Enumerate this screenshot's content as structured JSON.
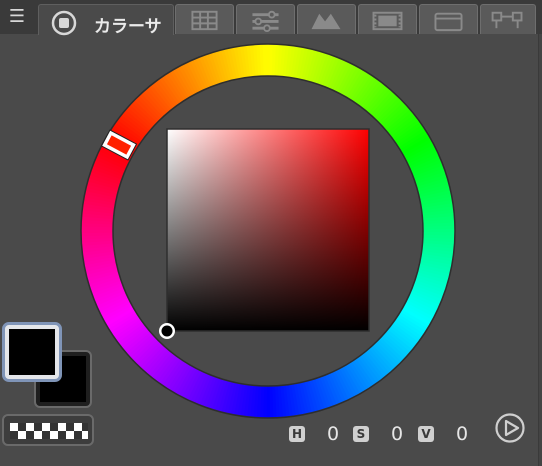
{
  "panel": {
    "menu_icon": "hamburger-icon",
    "active_tab": {
      "icon": "color-circle-icon",
      "label": "カラーサ"
    },
    "tabs": [
      {
        "name": "tab-color-set",
        "icon": "palette-grid-icon"
      },
      {
        "name": "tab-color-slider",
        "icon": "sliders-icon"
      },
      {
        "name": "tab-intermediate",
        "icon": "mountain-icon"
      },
      {
        "name": "tab-approximate",
        "icon": "film-icon"
      },
      {
        "name": "tab-history",
        "icon": "window-icon"
      },
      {
        "name": "tab-sub-view",
        "icon": "node-icon"
      }
    ]
  },
  "colors": {
    "main_color": "#000000",
    "sub_color": "#000000",
    "hue_marker_color": "#ff2200",
    "wheel_border": "#333333"
  },
  "readout": {
    "h_key": "H",
    "h_value": "0",
    "s_key": "S",
    "s_value": "0",
    "v_key": "V",
    "v_value": "0"
  },
  "play_icon": "play-circle-icon"
}
